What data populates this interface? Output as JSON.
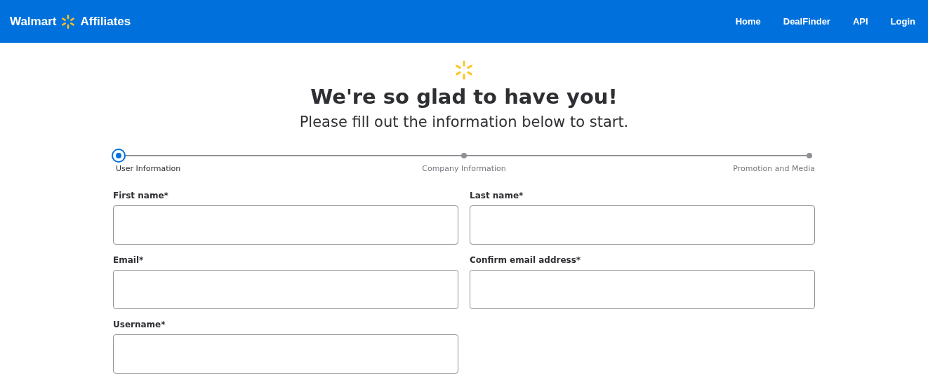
{
  "header": {
    "brand": "Walmart",
    "product": "Affiliates",
    "nav": [
      "Home",
      "DealFinder",
      "API",
      "Login"
    ]
  },
  "intro": {
    "title": "We're so glad to have you!",
    "subtitle": "Please fill out the information below to start."
  },
  "steps": [
    {
      "label": "User Information",
      "selected": true
    },
    {
      "label": "Company Information",
      "selected": false
    },
    {
      "label": "Promotion and Media",
      "selected": false
    }
  ],
  "fields": [
    {
      "label": "First name*"
    },
    {
      "label": "Last name*"
    },
    {
      "label": "Email*"
    },
    {
      "label": "Confirm email address*"
    },
    {
      "label": "Username*"
    }
  ]
}
